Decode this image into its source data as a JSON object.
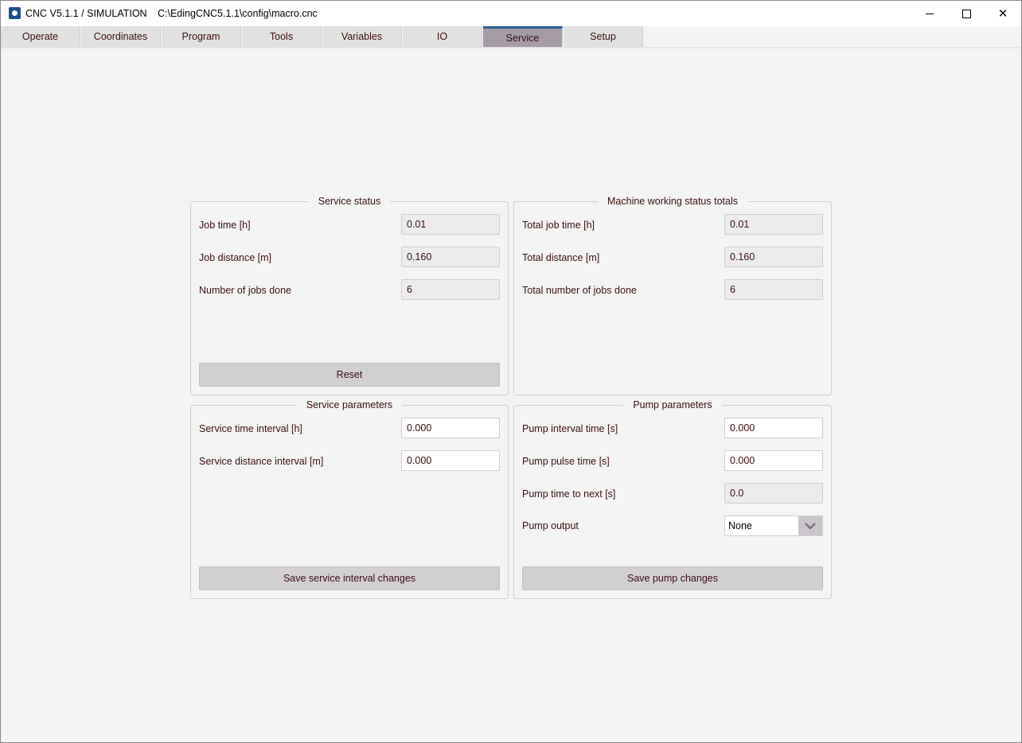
{
  "window": {
    "app_title": "CNC V5.1.1 / SIMULATION",
    "file_path": "C:\\EdingCNC5.1.1\\config\\macro.cnc"
  },
  "tabs": [
    {
      "label": "Operate"
    },
    {
      "label": "Coordinates"
    },
    {
      "label": "Program"
    },
    {
      "label": "Tools"
    },
    {
      "label": "Variables"
    },
    {
      "label": "IO"
    },
    {
      "label": "Service",
      "active": true
    },
    {
      "label": "Setup"
    }
  ],
  "service_status": {
    "title": "Service status",
    "job_time_label": "Job time [h]",
    "job_time_value": "0.01",
    "job_distance_label": "Job distance [m]",
    "job_distance_value": "0.160",
    "jobs_done_label": "Number of jobs done",
    "jobs_done_value": "6",
    "reset_label": "Reset"
  },
  "machine_totals": {
    "title": "Machine working status totals",
    "total_job_time_label": "Total job time [h]",
    "total_job_time_value": "0.01",
    "total_distance_label": "Total distance [m]",
    "total_distance_value": "0.160",
    "total_jobs_label": "Total number of jobs done",
    "total_jobs_value": "6"
  },
  "service_parameters": {
    "title": "Service parameters",
    "time_interval_label": "Service time interval [h]",
    "time_interval_value": "0.000",
    "distance_interval_label": "Service distance interval [m]",
    "distance_interval_value": "0.000",
    "save_label": "Save service interval changes"
  },
  "pump_parameters": {
    "title": "Pump parameters",
    "interval_label": "Pump interval time [s]",
    "interval_value": "0.000",
    "pulse_label": "Pump pulse time [s]",
    "pulse_value": "0.000",
    "time_to_next_label": "Pump time to next [s]",
    "time_to_next_value": "0.0",
    "output_label": "Pump output",
    "output_value": "None",
    "save_label": "Save pump changes"
  },
  "colors": {
    "active_tab": "#a59ca6",
    "active_tab_accent": "#2d5f93",
    "text": "#3a0f0f"
  }
}
